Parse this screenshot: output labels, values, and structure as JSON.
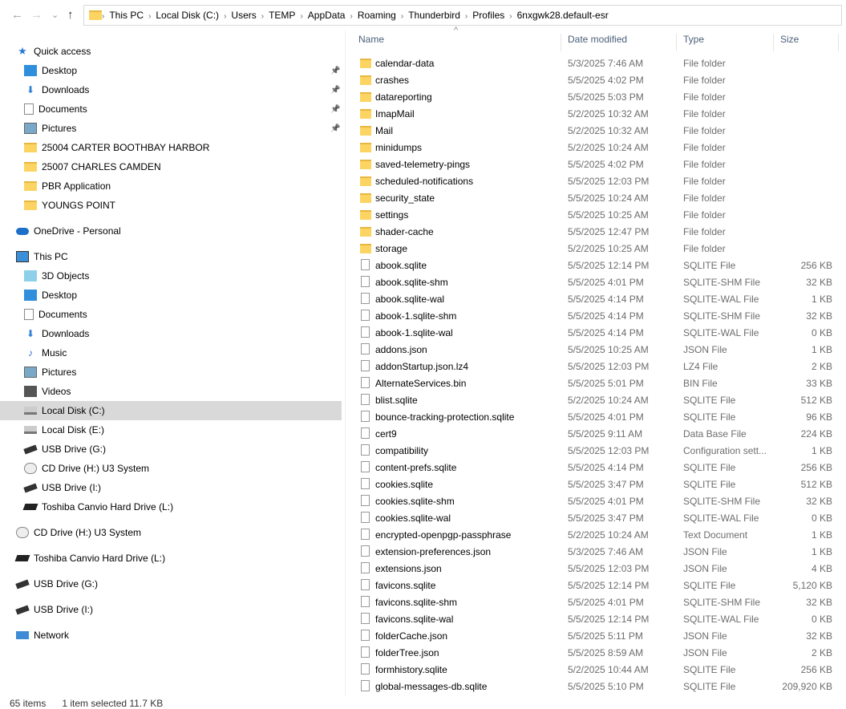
{
  "nav": {
    "back": "←",
    "forward": "→",
    "recent": "⌄",
    "up": "↑"
  },
  "breadcrumb": [
    "This PC",
    "Local Disk (C:)",
    "Users",
    "TEMP",
    "AppData",
    "Roaming",
    "Thunderbird",
    "Profiles",
    "6nxgwk28.default-esr"
  ],
  "columns": {
    "name": "Name",
    "date": "Date modified",
    "type": "Type",
    "size": "Size",
    "sort_indicator": "^"
  },
  "sidebar": [
    {
      "label": "Quick access",
      "icon": "star-icon",
      "indent": 0,
      "pinned": false
    },
    {
      "label": "Desktop",
      "icon": "desktop-icon",
      "indent": 1,
      "pinned": true
    },
    {
      "label": "Downloads",
      "icon": "download-icon",
      "indent": 1,
      "pinned": true
    },
    {
      "label": "Documents",
      "icon": "document-icon",
      "indent": 1,
      "pinned": true
    },
    {
      "label": "Pictures",
      "icon": "pictures-icon",
      "indent": 1,
      "pinned": true
    },
    {
      "label": "25004 CARTER BOOTHBAY HARBOR",
      "icon": "folder-icon",
      "indent": 1
    },
    {
      "label": "25007 CHARLES CAMDEN",
      "icon": "folder-icon",
      "indent": 1
    },
    {
      "label": "PBR Application",
      "icon": "folder-icon",
      "indent": 1
    },
    {
      "label": "YOUNGS POINT",
      "icon": "folder-icon",
      "indent": 1
    },
    {
      "label": "OneDrive - Personal",
      "icon": "cloud-icon",
      "indent": 0,
      "gap": true
    },
    {
      "label": "This PC",
      "icon": "computer-icon",
      "indent": 0,
      "gap": true
    },
    {
      "label": "3D Objects",
      "icon": "cube-icon",
      "indent": 1
    },
    {
      "label": "Desktop",
      "icon": "desktop-icon",
      "indent": 1
    },
    {
      "label": "Documents",
      "icon": "document-icon",
      "indent": 1
    },
    {
      "label": "Downloads",
      "icon": "download-icon",
      "indent": 1
    },
    {
      "label": "Music",
      "icon": "music-icon",
      "indent": 1
    },
    {
      "label": "Pictures",
      "icon": "pictures-icon",
      "indent": 1
    },
    {
      "label": "Videos",
      "icon": "video-icon",
      "indent": 1
    },
    {
      "label": "Local Disk (C:)",
      "icon": "drive-icon",
      "indent": 1,
      "selected": true
    },
    {
      "label": "Local Disk (E:)",
      "icon": "drive-icon",
      "indent": 1
    },
    {
      "label": "USB Drive (G:)",
      "icon": "usb-icon",
      "indent": 1
    },
    {
      "label": "CD Drive (H:) U3 System",
      "icon": "cd-icon",
      "indent": 1
    },
    {
      "label": "USB Drive (I:)",
      "icon": "usb-icon",
      "indent": 1
    },
    {
      "label": "Toshiba Canvio Hard Drive (L:)",
      "icon": "hdd-icon",
      "indent": 1
    },
    {
      "label": "CD Drive (H:) U3 System",
      "icon": "cd-icon",
      "indent": 0,
      "gap": true
    },
    {
      "label": "Toshiba Canvio Hard Drive (L:)",
      "icon": "hdd-icon",
      "indent": 0,
      "gap": true
    },
    {
      "label": "USB Drive (G:)",
      "icon": "usb-icon",
      "indent": 0,
      "gap": true
    },
    {
      "label": "USB Drive (I:)",
      "icon": "usb-icon",
      "indent": 0,
      "gap": true
    },
    {
      "label": "Network",
      "icon": "network-icon",
      "indent": 0,
      "gap": true
    }
  ],
  "files": [
    [
      "calendar-data",
      "5/3/2025 7:46 AM",
      "File folder",
      ""
    ],
    [
      "crashes",
      "5/5/2025 4:02 PM",
      "File folder",
      ""
    ],
    [
      "datareporting",
      "5/5/2025 5:03 PM",
      "File folder",
      ""
    ],
    [
      "ImapMail",
      "5/2/2025 10:32 AM",
      "File folder",
      ""
    ],
    [
      "Mail",
      "5/2/2025 10:32 AM",
      "File folder",
      ""
    ],
    [
      "minidumps",
      "5/2/2025 10:24 AM",
      "File folder",
      ""
    ],
    [
      "saved-telemetry-pings",
      "5/5/2025 4:02 PM",
      "File folder",
      ""
    ],
    [
      "scheduled-notifications",
      "5/5/2025 12:03 PM",
      "File folder",
      ""
    ],
    [
      "security_state",
      "5/5/2025 10:24 AM",
      "File folder",
      ""
    ],
    [
      "settings",
      "5/5/2025 10:25 AM",
      "File folder",
      ""
    ],
    [
      "shader-cache",
      "5/5/2025 12:47 PM",
      "File folder",
      ""
    ],
    [
      "storage",
      "5/2/2025 10:25 AM",
      "File folder",
      ""
    ],
    [
      "abook.sqlite",
      "5/5/2025 12:14 PM",
      "SQLITE File",
      "256 KB"
    ],
    [
      "abook.sqlite-shm",
      "5/5/2025 4:01 PM",
      "SQLITE-SHM File",
      "32 KB"
    ],
    [
      "abook.sqlite-wal",
      "5/5/2025 4:14 PM",
      "SQLITE-WAL File",
      "1 KB"
    ],
    [
      "abook-1.sqlite-shm",
      "5/5/2025 4:14 PM",
      "SQLITE-SHM File",
      "32 KB"
    ],
    [
      "abook-1.sqlite-wal",
      "5/5/2025 4:14 PM",
      "SQLITE-WAL File",
      "0 KB"
    ],
    [
      "addons.json",
      "5/5/2025 10:25 AM",
      "JSON File",
      "1 KB"
    ],
    [
      "addonStartup.json.lz4",
      "5/5/2025 12:03 PM",
      "LZ4 File",
      "2 KB"
    ],
    [
      "AlternateServices.bin",
      "5/5/2025 5:01 PM",
      "BIN File",
      "33 KB"
    ],
    [
      "blist.sqlite",
      "5/2/2025 10:24 AM",
      "SQLITE File",
      "512 KB"
    ],
    [
      "bounce-tracking-protection.sqlite",
      "5/5/2025 4:01 PM",
      "SQLITE File",
      "96 KB"
    ],
    [
      "cert9",
      "5/5/2025 9:11 AM",
      "Data Base File",
      "224 KB"
    ],
    [
      "compatibility",
      "5/5/2025 12:03 PM",
      "Configuration sett...",
      "1 KB"
    ],
    [
      "content-prefs.sqlite",
      "5/5/2025 4:14 PM",
      "SQLITE File",
      "256 KB"
    ],
    [
      "cookies.sqlite",
      "5/5/2025 3:47 PM",
      "SQLITE File",
      "512 KB"
    ],
    [
      "cookies.sqlite-shm",
      "5/5/2025 4:01 PM",
      "SQLITE-SHM File",
      "32 KB"
    ],
    [
      "cookies.sqlite-wal",
      "5/5/2025 3:47 PM",
      "SQLITE-WAL File",
      "0 KB"
    ],
    [
      "encrypted-openpgp-passphrase",
      "5/2/2025 10:24 AM",
      "Text Document",
      "1 KB"
    ],
    [
      "extension-preferences.json",
      "5/3/2025 7:46 AM",
      "JSON File",
      "1 KB"
    ],
    [
      "extensions.json",
      "5/5/2025 12:03 PM",
      "JSON File",
      "4 KB"
    ],
    [
      "favicons.sqlite",
      "5/5/2025 12:14 PM",
      "SQLITE File",
      "5,120 KB"
    ],
    [
      "favicons.sqlite-shm",
      "5/5/2025 4:01 PM",
      "SQLITE-SHM File",
      "32 KB"
    ],
    [
      "favicons.sqlite-wal",
      "5/5/2025 12:14 PM",
      "SQLITE-WAL File",
      "0 KB"
    ],
    [
      "folderCache.json",
      "5/5/2025 5:11 PM",
      "JSON File",
      "32 KB"
    ],
    [
      "folderTree.json",
      "5/5/2025 8:59 AM",
      "JSON File",
      "2 KB"
    ],
    [
      "formhistory.sqlite",
      "5/2/2025 10:44 AM",
      "SQLITE File",
      "256 KB"
    ],
    [
      "global-messages-db.sqlite",
      "5/5/2025 5:10 PM",
      "SQLITE File",
      "209,920 KB"
    ]
  ],
  "status": {
    "count": "65 items",
    "selected": "1 item selected  11.7 KB"
  },
  "colors": {
    "folder": "#fcd462",
    "selected": "#d9d9d9",
    "header": "#4c607a"
  }
}
